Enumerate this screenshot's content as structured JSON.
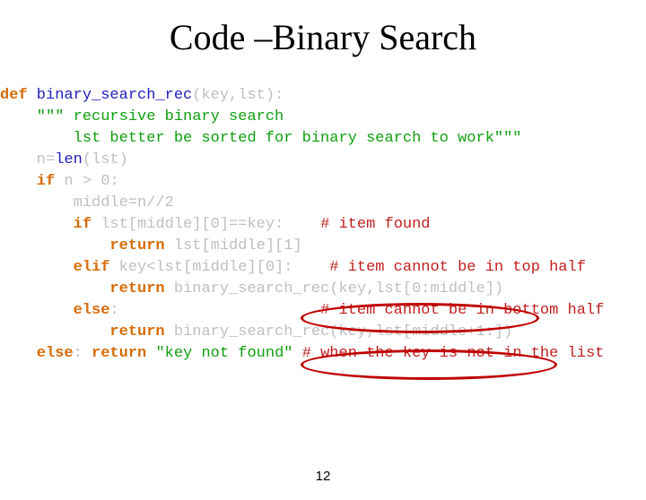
{
  "title": "Code –Binary Search",
  "page_number": "12",
  "code": {
    "l1a": "def",
    "l1b": " binary_search_rec",
    "l1c": "(key,lst):",
    "l2": "    \"\"\" recursive binary search",
    "l3": "        lst better be sorted for binary search to work\"\"\"",
    "l4a": "    n=",
    "l4b": "len",
    "l4c": "(lst)",
    "l5a": "    if",
    "l5b": " n > 0",
    "l5c": ":",
    "l6": "        middle=n//2",
    "l7a": "        if",
    "l7b": " lst[middle][0]==key:    ",
    "l7c": "# item found",
    "l8a": "            return",
    "l8b": " lst[middle][1]",
    "l9a": "        elif",
    "l9b": " key<lst[middle][0]:    ",
    "l9c": "# item cannot be in top half",
    "l10a": "            return",
    "l10b": " binary_search_rec(key,lst[0:middle])",
    "l11a": "        else",
    "l11b": ":                      ",
    "l11c": "# item cannot be in bottom half",
    "l12a": "            return",
    "l12b": " binary_search_rec(key,lst[middle+1:])",
    "l13a": "    else",
    "l13b": ": ",
    "l13c": "return",
    "l13d": " ",
    "l13e": "\"key not found\"",
    "l13f": " ",
    "l13g": "# when the key is not in the list"
  }
}
